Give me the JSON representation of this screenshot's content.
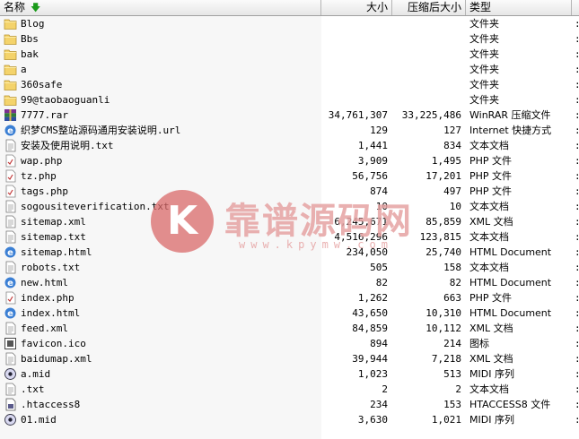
{
  "columns": {
    "name": "名称",
    "size": "大小",
    "compressed": "压缩后大小",
    "type": "类型"
  },
  "sort_icon": "green-down-arrow-icon",
  "watermark": {
    "text": "靠谱源码网",
    "url": "www.kpymw.com"
  },
  "files": [
    {
      "name": "Blog",
      "size": "",
      "compressed": "",
      "type": "文件夹",
      "icon": "folder"
    },
    {
      "name": "Bbs",
      "size": "",
      "compressed": "",
      "type": "文件夹",
      "icon": "folder"
    },
    {
      "name": "bak",
      "size": "",
      "compressed": "",
      "type": "文件夹",
      "icon": "folder"
    },
    {
      "name": "a",
      "size": "",
      "compressed": "",
      "type": "文件夹",
      "icon": "folder"
    },
    {
      "name": "360safe",
      "size": "",
      "compressed": "",
      "type": "文件夹",
      "icon": "folder"
    },
    {
      "name": "99@taobaoguanli",
      "size": "",
      "compressed": "",
      "type": "文件夹",
      "icon": "folder"
    },
    {
      "name": "7777.rar",
      "size": "34,761,307",
      "compressed": "33,225,486",
      "type": "WinRAR 压缩文件",
      "icon": "rar"
    },
    {
      "name": "织梦CMS整站源码通用安装说明.url",
      "size": "129",
      "compressed": "127",
      "type": "Internet 快捷方式",
      "icon": "ie"
    },
    {
      "name": "安装及使用说明.txt",
      "size": "1,441",
      "compressed": "834",
      "type": "文本文档",
      "icon": "text"
    },
    {
      "name": "wap.php",
      "size": "3,909",
      "compressed": "1,495",
      "type": "PHP 文件",
      "icon": "php"
    },
    {
      "name": "tz.php",
      "size": "56,756",
      "compressed": "17,201",
      "type": "PHP 文件",
      "icon": "php"
    },
    {
      "name": "tags.php",
      "size": "874",
      "compressed": "497",
      "type": "PHP 文件",
      "icon": "php"
    },
    {
      "name": "sogousiteverification.txt",
      "size": "10",
      "compressed": "10",
      "type": "文本文档",
      "icon": "text"
    },
    {
      "name": "sitemap.xml",
      "size": "6,245,671",
      "compressed": "85,859",
      "type": "XML 文档",
      "icon": "text"
    },
    {
      "name": "sitemap.txt",
      "size": "4,516,296",
      "compressed": "123,815",
      "type": "文本文档",
      "icon": "text"
    },
    {
      "name": "sitemap.html",
      "size": "234,050",
      "compressed": "25,740",
      "type": "HTML Document",
      "icon": "ie"
    },
    {
      "name": "robots.txt",
      "size": "505",
      "compressed": "158",
      "type": "文本文档",
      "icon": "text"
    },
    {
      "name": "new.html",
      "size": "82",
      "compressed": "82",
      "type": "HTML Document",
      "icon": "ie"
    },
    {
      "name": "index.php",
      "size": "1,262",
      "compressed": "663",
      "type": "PHP 文件",
      "icon": "php"
    },
    {
      "name": "index.html",
      "size": "43,650",
      "compressed": "10,310",
      "type": "HTML Document",
      "icon": "ie"
    },
    {
      "name": "feed.xml",
      "size": "84,859",
      "compressed": "10,112",
      "type": "XML 文档",
      "icon": "text"
    },
    {
      "name": "favicon.ico",
      "size": "894",
      "compressed": "214",
      "type": "图标",
      "icon": "ico"
    },
    {
      "name": "baidumap.xml",
      "size": "39,944",
      "compressed": "7,218",
      "type": "XML 文档",
      "icon": "text"
    },
    {
      "name": "a.mid",
      "size": "1,023",
      "compressed": "513",
      "type": "MIDI 序列",
      "icon": "midi"
    },
    {
      "name": ".txt",
      "size": "2",
      "compressed": "2",
      "type": "文本文档",
      "icon": "text"
    },
    {
      "name": ".htaccess8",
      "size": "234",
      "compressed": "153",
      "type": "HTACCESS8 文件",
      "icon": "generic"
    },
    {
      "name": "01.mid",
      "size": "3,630",
      "compressed": "1,021",
      "type": "MIDI 序列",
      "icon": "midi"
    }
  ]
}
